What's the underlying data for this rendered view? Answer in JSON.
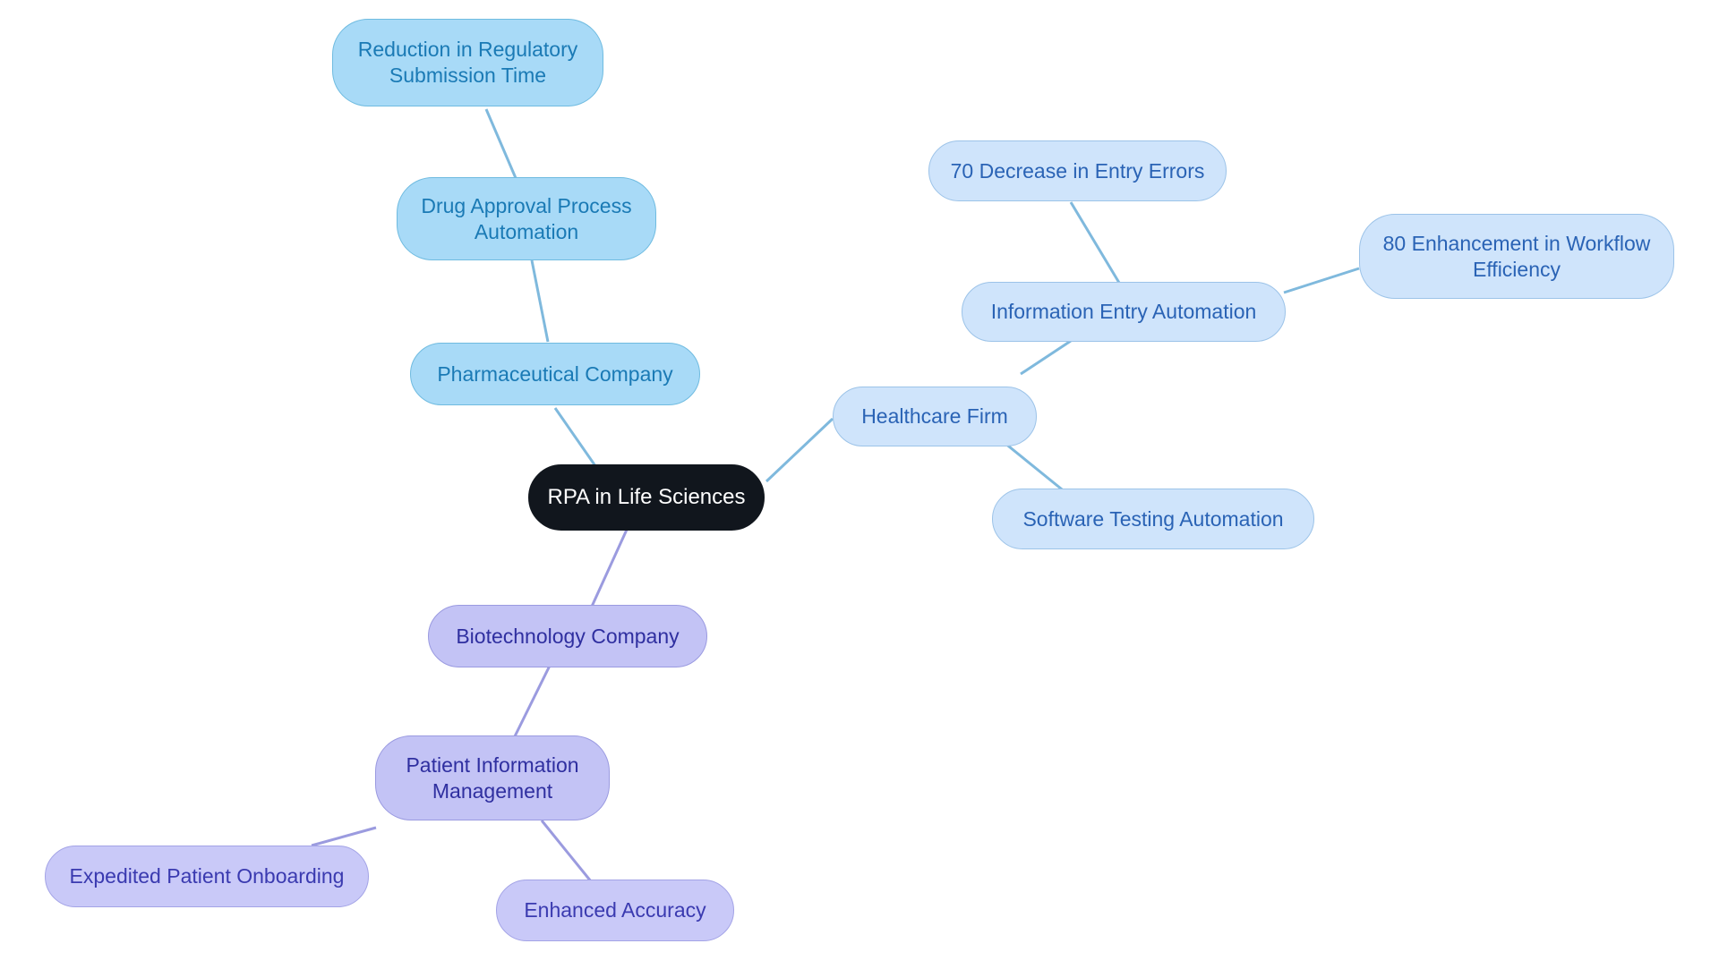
{
  "diagram": {
    "type": "mindmap",
    "title": "RPA in Life Sciences",
    "background_color": "#ffffff",
    "edge_colors": {
      "blue": "#7fb9dd",
      "purple": "#9b9bdf"
    },
    "nodes": {
      "root": {
        "label": "RPA in Life Sciences",
        "fill": "#11161d",
        "text_color": "#ffffff"
      },
      "pharmaceutical_company": {
        "label": "Pharmaceutical Company",
        "fill": "#a8daf7",
        "text_color": "#1a7ab5"
      },
      "drug_approval_process_automation": {
        "label": "Drug Approval Process\nAutomation",
        "fill": "#a8daf7",
        "text_color": "#1a7ab5"
      },
      "reduction_in_regulatory_submission_time": {
        "label": "Reduction in Regulatory\nSubmission Time",
        "fill": "#a8daf7",
        "text_color": "#1a7ab5"
      },
      "healthcare_firm": {
        "label": "Healthcare Firm",
        "fill": "#cfe4fb",
        "text_color": "#2a63b5"
      },
      "information_entry_automation": {
        "label": "Information Entry Automation",
        "fill": "#cfe4fb",
        "text_color": "#2a63b5"
      },
      "decrease_in_entry_errors": {
        "label": "70 Decrease in Entry Errors",
        "fill": "#cfe4fb",
        "text_color": "#2a63b5"
      },
      "enhancement_in_workflow_efficiency": {
        "label": "80 Enhancement in Workflow\nEfficiency",
        "fill": "#cfe4fb",
        "text_color": "#2a63b5"
      },
      "software_testing_automation": {
        "label": "Software Testing Automation",
        "fill": "#cfe4fb",
        "text_color": "#2a63b5"
      },
      "biotechnology_company": {
        "label": "Biotechnology Company",
        "fill": "#c3c3f5",
        "text_color": "#2f2fa0"
      },
      "patient_information_management": {
        "label": "Patient Information\nManagement",
        "fill": "#c3c3f5",
        "text_color": "#2f2fa0"
      },
      "expedited_patient_onboarding": {
        "label": "Expedited Patient Onboarding",
        "fill": "#c9c9f8",
        "text_color": "#3a3ab0"
      },
      "enhanced_accuracy": {
        "label": "Enhanced Accuracy",
        "fill": "#c9c9f8",
        "text_color": "#3a3ab0"
      }
    }
  }
}
